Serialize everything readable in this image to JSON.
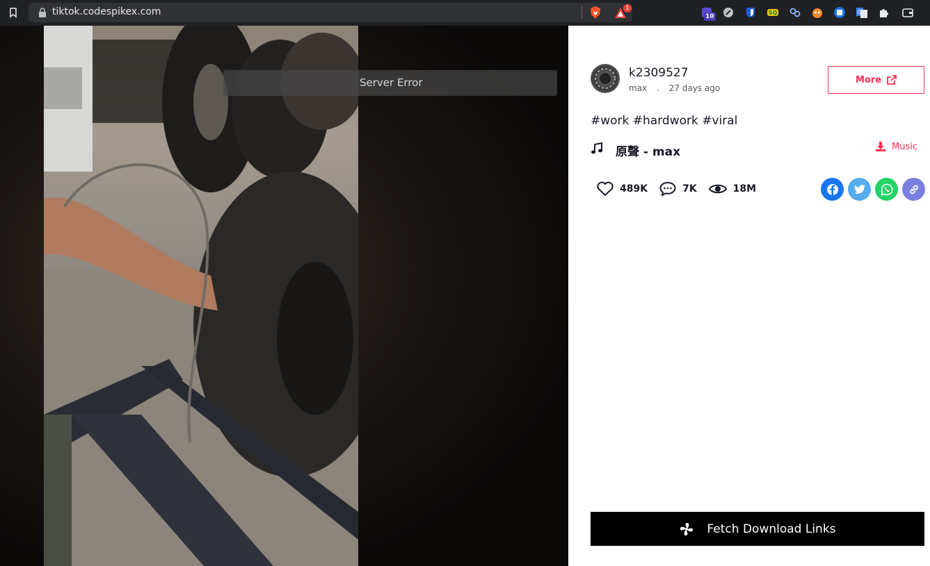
{
  "browser": {
    "url": "tiktok.codespikex.com",
    "rewards_badge": "1",
    "extension_badge": "10"
  },
  "video": {
    "error_message": "Server Error"
  },
  "author": {
    "username": "k2309527",
    "nickname": "max",
    "separator": ".",
    "posted": "27 days ago"
  },
  "actions": {
    "more_label": "More",
    "music_download_label": "Music",
    "fetch_label": "Fetch Download Links"
  },
  "caption": "#work #hardwork #viral",
  "music": {
    "title": "原聲 - max"
  },
  "stats": {
    "likes": "489K",
    "comments": "7K",
    "views": "18M"
  },
  "colors": {
    "accent": "#fe2c55",
    "facebook": "#1877f2",
    "twitter": "#55acee",
    "whatsapp": "#25d366",
    "copy_link": "#7b7fe0"
  }
}
